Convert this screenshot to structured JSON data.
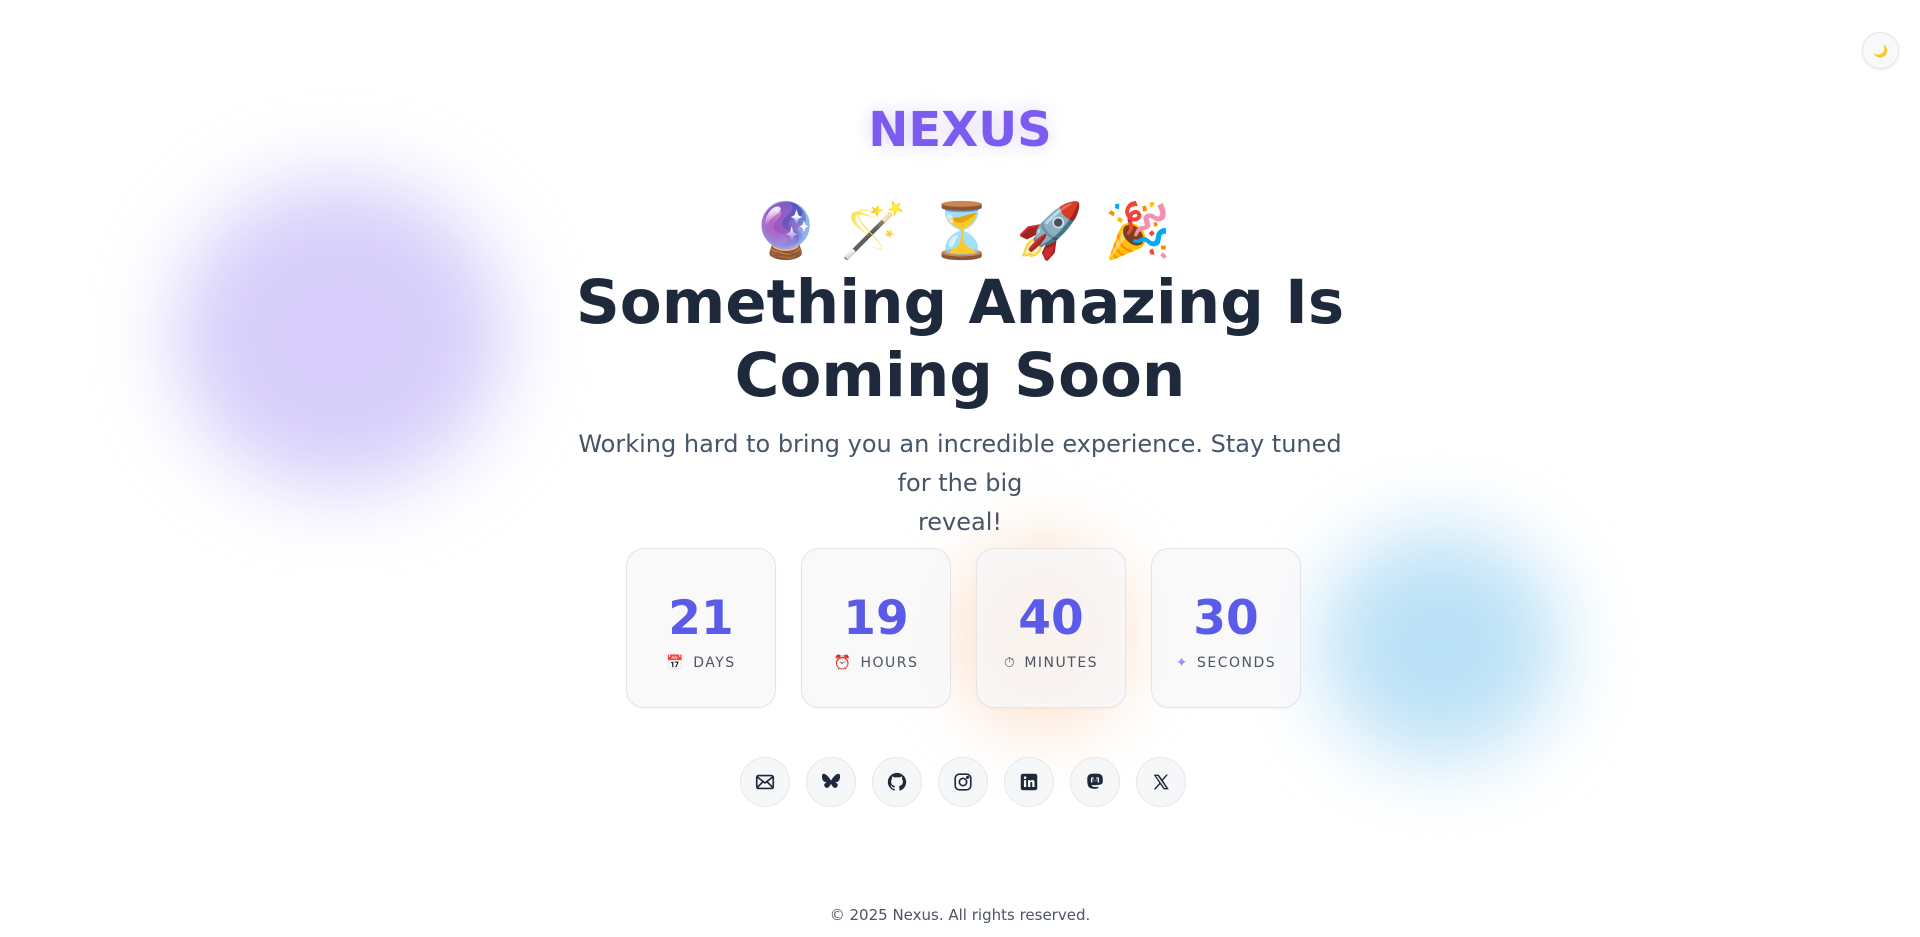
{
  "brand": {
    "name": "NEXUS"
  },
  "theme_toggle": {
    "icon": "🌙",
    "icon_name": "moon-icon"
  },
  "emojis": [
    {
      "glyph": "🔮",
      "name": "crystal-ball-icon"
    },
    {
      "glyph": "🪄",
      "name": "magic-wand-icon"
    },
    {
      "glyph": "⏳",
      "name": "hourglass-icon"
    },
    {
      "glyph": "🚀",
      "name": "rocket-icon"
    },
    {
      "glyph": "🎉",
      "name": "party-popper-icon"
    }
  ],
  "hero": {
    "title_line1": "Something Amazing Is",
    "title_line2": "Coming Soon",
    "subtitle_line1": "Working hard to bring you an incredible experience. Stay tuned for the big",
    "subtitle_line2": "reveal!"
  },
  "countdown": [
    {
      "value": "21",
      "label": "DAYS",
      "icon": "📅",
      "icon_name": "calendar-icon"
    },
    {
      "value": "19",
      "label": "HOURS",
      "icon": "⏰",
      "icon_name": "alarm-clock-icon"
    },
    {
      "value": "40",
      "label": "MINUTES",
      "icon": "⏱",
      "icon_name": "stopwatch-icon"
    },
    {
      "value": "30",
      "label": "SECONDS",
      "icon": "✦",
      "icon_name": "sparkle-icon"
    }
  ],
  "socials": [
    {
      "name": "email-icon"
    },
    {
      "name": "bluesky-icon"
    },
    {
      "name": "github-icon"
    },
    {
      "name": "instagram-icon"
    },
    {
      "name": "linkedin-icon"
    },
    {
      "name": "mastodon-icon"
    },
    {
      "name": "x-icon"
    }
  ],
  "footer": {
    "text": "© 2025 Nexus. All rights reserved."
  },
  "colors": {
    "brand": "#7c5cf0",
    "count_value": "#5b5bea",
    "heading": "#1e293b",
    "subtitle": "#475569"
  }
}
